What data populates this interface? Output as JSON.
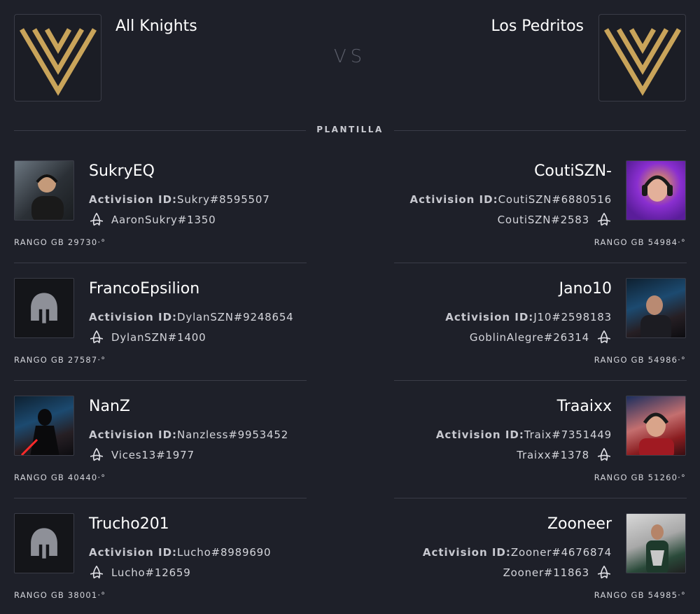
{
  "match": {
    "team_a": {
      "name": "All Knights",
      "logo_icon": "gold-v-logo-icon"
    },
    "team_b": {
      "name": "Los Pedritos",
      "logo_icon": "gold-v-logo-icon"
    },
    "vs_label": "VS",
    "section_title": "PLANTILLA"
  },
  "colors": {
    "background": "#1e2029",
    "gold": "#c9a45a",
    "divider": "#3a3c47"
  },
  "activision_label": "Activision ID:",
  "left_players": [
    {
      "name": "SukryEQ",
      "activision_id": "Sukry#8595507",
      "battlenet": "AaronSukry#1350",
      "rank": "RANGO GB 29730·°",
      "avatar": "player-photo"
    },
    {
      "name": "FrancoEpsilion",
      "activision_id": "DylanSZN#9248654",
      "battlenet": "DylanSZN#1400",
      "rank": "RANGO GB 27587·°",
      "avatar": "helmet-icon"
    },
    {
      "name": "NanZ",
      "activision_id": "Nanzless#9953452",
      "battlenet": "Vices13#1977",
      "rank": "RANGO GB 40440·°",
      "avatar": "darth-vader-image"
    },
    {
      "name": "Trucho201",
      "activision_id": "Lucho#8989690",
      "battlenet": "Lucho#12659",
      "rank": "RANGO GB 38001·°",
      "avatar": "helmet-icon"
    }
  ],
  "right_players": [
    {
      "name": "CoutiSZN-",
      "activision_id": "CoutiSZN#6880516",
      "battlenet": "CoutiSZN#2583",
      "rank": "RANGO GB 54984·°",
      "avatar": "player-photo"
    },
    {
      "name": "Jano10",
      "activision_id": "J10#2598183",
      "battlenet": "GoblinAlegre#26314",
      "rank": "RANGO GB 54986·°",
      "avatar": "player-photo"
    },
    {
      "name": "Traaixx",
      "activision_id": "Traix#7351449",
      "battlenet": "Traixx#1378",
      "rank": "RANGO GB 51260·°",
      "avatar": "player-photo"
    },
    {
      "name": "Zooneer",
      "activision_id": "Zooner#4676874",
      "battlenet": "Zooner#11863",
      "rank": "RANGO GB 54985·°",
      "avatar": "player-photo"
    }
  ]
}
